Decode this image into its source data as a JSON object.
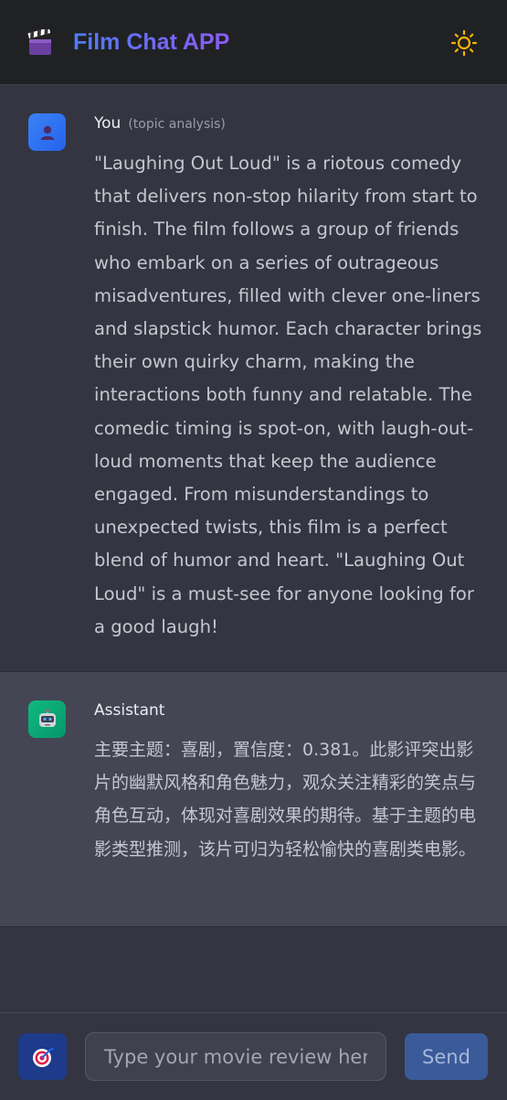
{
  "header": {
    "title": "Film Chat APP",
    "logo_icon": "clapperboard-icon",
    "theme_icon": "sun-icon"
  },
  "messages": {
    "user": {
      "author": "You",
      "tag": "(topic analysis)",
      "text": "\"Laughing Out Loud\" is a riotous comedy that delivers non-stop hilarity from start to finish. The film follows a group of friends who embark on a series of outrageous misadventures, filled with clever one-liners and slapstick humor. Each character brings their own quirky charm, making the interactions both funny and relatable. The comedic timing is spot-on, with laugh-out-loud moments that keep the audience engaged. From misunderstandings to unexpected twists, this film is a perfect blend of humor and heart. \"Laughing Out Loud\" is a must-see for anyone looking for a good laugh!"
    },
    "assistant": {
      "author": "Assistant",
      "text": "主要主题：喜剧，置信度：0.381。此影评突出影片的幽默风格和角色魅力，观众关注精彩的笑点与角色互动，体现对喜剧效果的期待。基于主题的电影类型推测，该片可归为轻松愉快的喜剧类电影。"
    }
  },
  "composer": {
    "placeholder": "Type your movie review here...",
    "value": "",
    "send_label": "Send",
    "mode_icon": "target-icon"
  },
  "colors": {
    "header_bg": "#202123",
    "chat_bg": "#343541",
    "assistant_bg": "#444654",
    "accent": "#3b5a9a"
  }
}
